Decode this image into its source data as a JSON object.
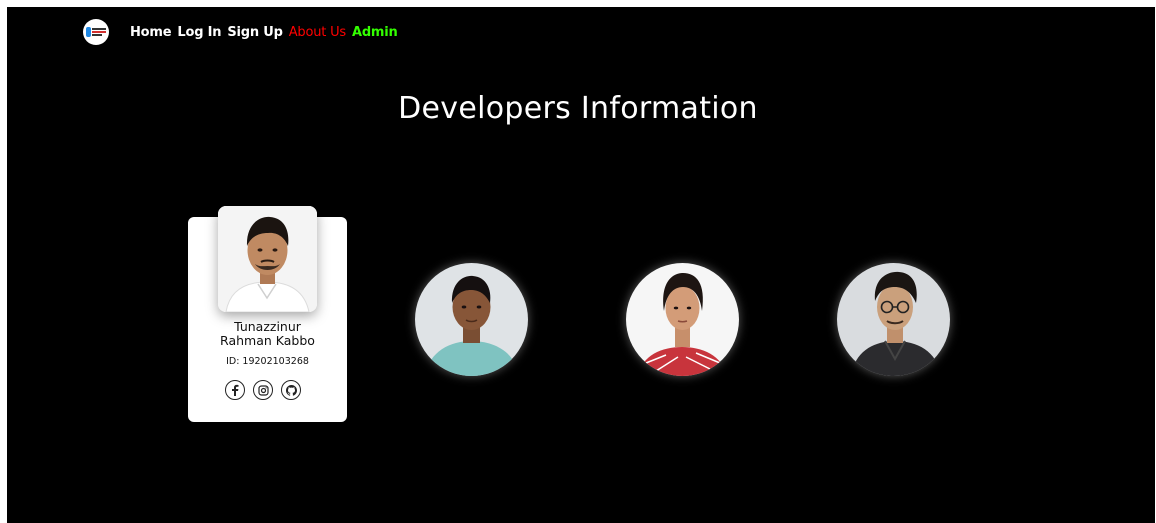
{
  "nav": {
    "logo_icon": "site-logo-icon",
    "links": {
      "home": "Home",
      "login": "Log In",
      "signup": "Sign Up",
      "about": "About Us",
      "admin": "Admin"
    },
    "colors": {
      "about": "#ff0000",
      "admin": "#33ff00"
    }
  },
  "page": {
    "heading": "Developers Information"
  },
  "developers": {
    "featured": {
      "name_line1": "Tunazzinur",
      "name_line2": "Rahman Kabbo",
      "id": "ID: 19202103268",
      "socials": [
        "facebook-icon",
        "instagram-icon",
        "github-icon"
      ]
    },
    "others": [
      {
        "avatar": "developer-photo-2"
      },
      {
        "avatar": "developer-photo-3"
      },
      {
        "avatar": "developer-photo-4"
      }
    ]
  }
}
